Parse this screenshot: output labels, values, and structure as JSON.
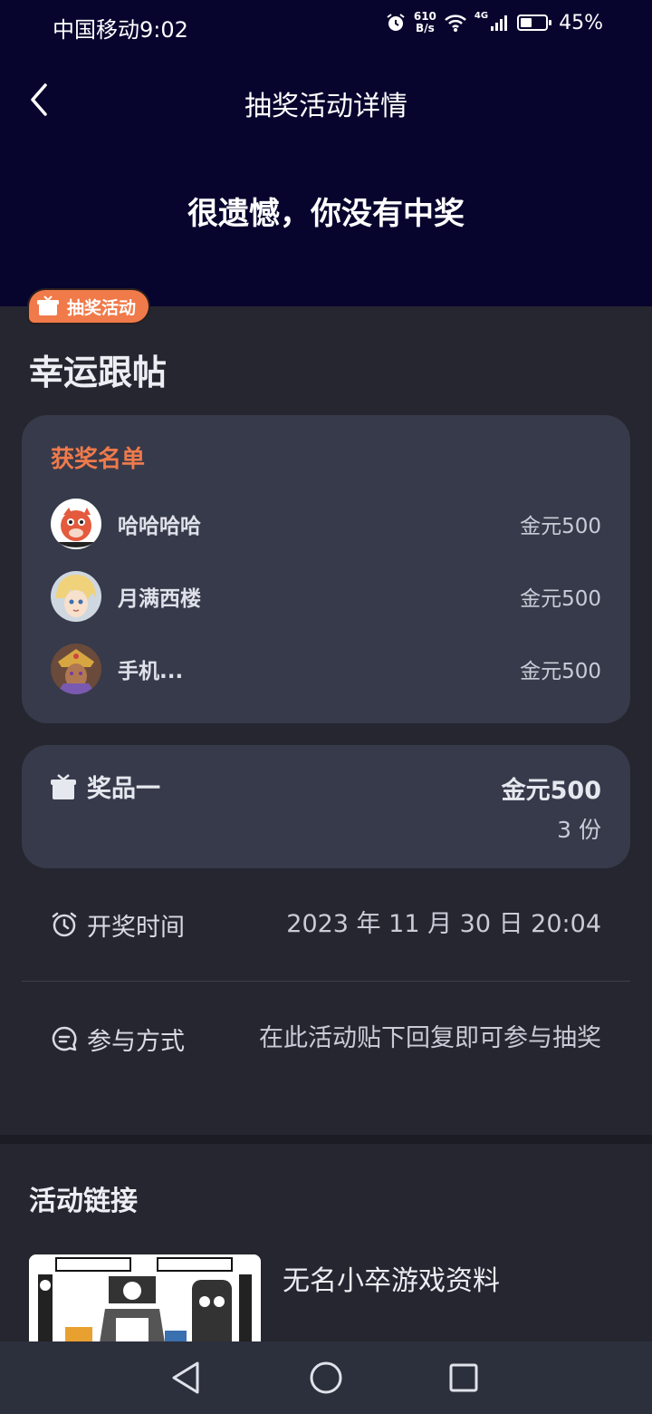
{
  "status_bar": {
    "carrier_time": "中国移动9:02",
    "speed_top": "610",
    "speed_bottom": "B/s",
    "network": "4G",
    "battery": "45%"
  },
  "nav": {
    "title": "抽奖活动详情"
  },
  "result_text": "很遗憾，你没有中奖",
  "badge": {
    "label": "抽奖活动"
  },
  "activity_title": "幸运跟帖",
  "winners": {
    "title": "获奖名单",
    "rows": [
      {
        "name": "哈哈哈哈",
        "prize": "金元500"
      },
      {
        "name": "月满西楼",
        "prize": "金元500"
      },
      {
        "name": "手机...",
        "prize": "金元500"
      }
    ]
  },
  "prize": {
    "label": "奖品一",
    "value": "金元500",
    "quantity": "3 份"
  },
  "draw_time": {
    "label": "开奖时间",
    "value": "2023 年 11 月 30 日 20:04"
  },
  "participation": {
    "label": "参与方式",
    "value": "在此活动贴下回复即可参与抽奖"
  },
  "links": {
    "title": "活动链接",
    "item_title": "无名小卒游戏资料"
  },
  "colors": {
    "accent": "#ee7a4c",
    "header_bg": "#07042e",
    "card_bg": "#373a4a"
  },
  "battery_level": 0.45
}
